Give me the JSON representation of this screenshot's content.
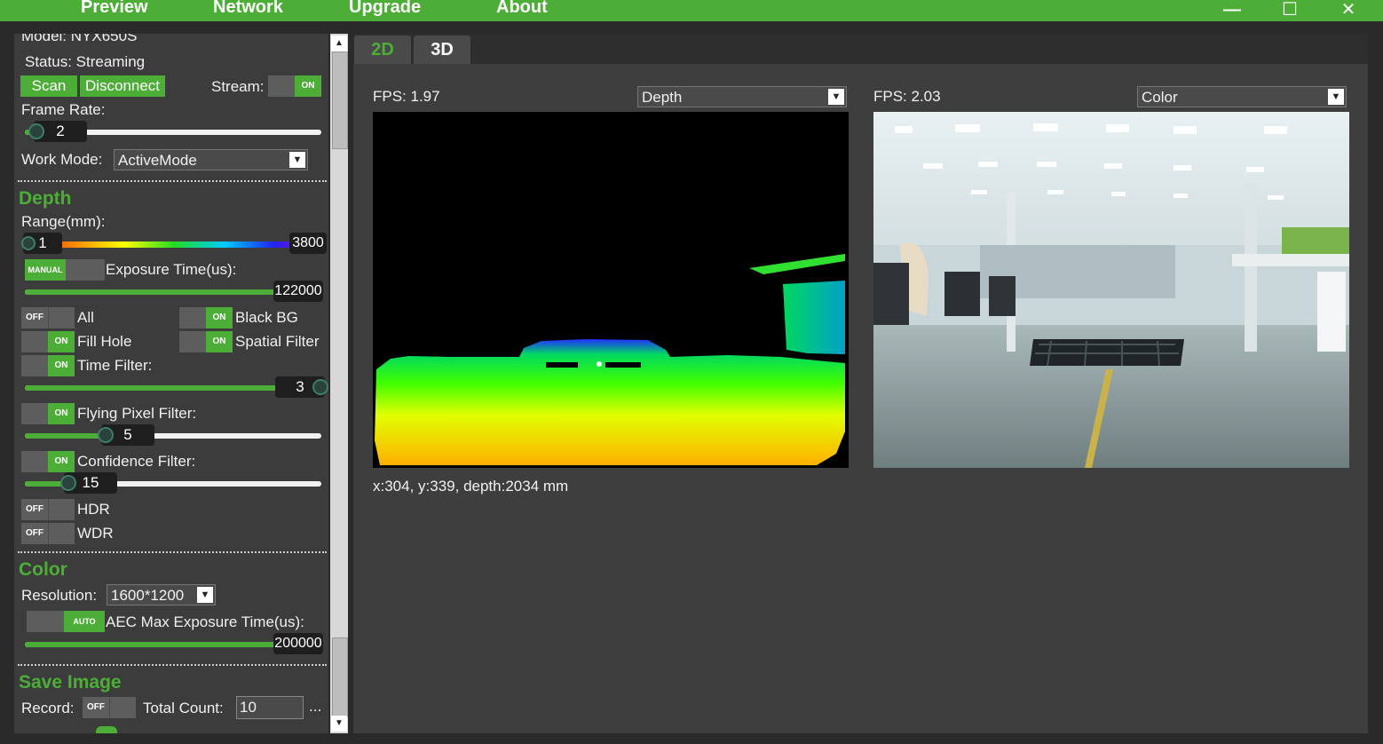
{
  "menu": {
    "preview": "Preview",
    "network": "Network",
    "upgrade": "Upgrade",
    "about": "About"
  },
  "window_buttons": {
    "minimize": "—",
    "maximize": "☐",
    "close": "✕"
  },
  "device": {
    "model": "Model: NYX650S",
    "status": "Status: Streaming",
    "scan_label": "Scan",
    "disconnect_label": "Disconnect",
    "stream_label": "Stream:",
    "stream_toggle": "ON",
    "frame_rate_label": "Frame Rate:",
    "frame_rate_value": "2",
    "work_mode_label": "Work Mode:",
    "work_mode_value": "ActiveMode"
  },
  "depth": {
    "title": "Depth",
    "range_label": "Range(mm):",
    "range_min": "1",
    "range_max": "3800",
    "exposure_toggle": "MANUAL",
    "exposure_label": "Exposure Time(us):",
    "exposure_value": "122000",
    "all_toggle": "OFF",
    "all_label": "All",
    "blackbg_toggle": "ON",
    "blackbg_label": "Black BG",
    "fillhole_toggle": "ON",
    "fillhole_label": "Fill Hole",
    "spatial_toggle": "ON",
    "spatial_label": "Spatial Filter",
    "time_toggle": "ON",
    "time_label": "Time Filter:",
    "time_value": "3",
    "flying_toggle": "ON",
    "flying_label": "Flying Pixel Filter:",
    "flying_value": "5",
    "confidence_toggle": "ON",
    "confidence_label": "Confidence Filter:",
    "confidence_value": "15",
    "hdr_toggle": "OFF",
    "hdr_label": "HDR",
    "wdr_toggle": "OFF",
    "wdr_label": "WDR"
  },
  "color": {
    "title": "Color",
    "resolution_label": "Resolution:",
    "resolution_value": "1600*1200",
    "aec_toggle": "AUTO",
    "aec_label": "AEC Max Exposure Time(us):",
    "aec_value": "200000"
  },
  "save_image": {
    "title": "Save Image",
    "record_label": "Record:",
    "record_toggle": "OFF",
    "total_count_label": "Total Count:",
    "total_count_value": "10",
    "more": "..."
  },
  "tabs": {
    "tab_2d": "2D",
    "tab_3d": "3D"
  },
  "views": {
    "left_fps": "FPS: 1.97",
    "left_mode": "Depth",
    "right_fps": "FPS: 2.03",
    "right_mode": "Color",
    "pixel_info": "x:304, y:339, depth:2034 mm"
  },
  "colors": {
    "accent": "#4cae37",
    "panel": "#3c3c3c",
    "frame": "#2a2a2a"
  }
}
